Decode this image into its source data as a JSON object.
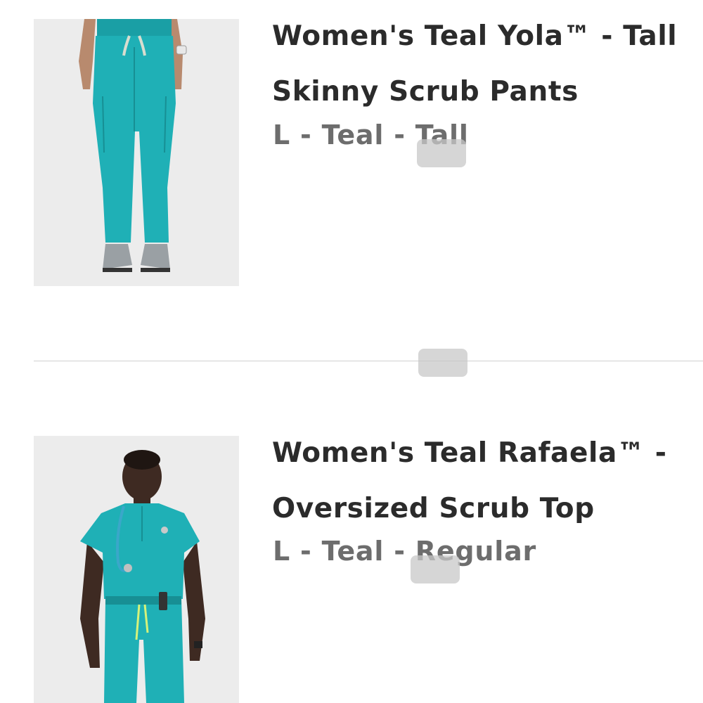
{
  "products": [
    {
      "title_line1": "Women's Teal Yola™ - Tall",
      "title_line2": "Skinny Scrub Pants",
      "variant": "L - Teal - Tall",
      "image": "teal-skinny-scrub-pants-photo"
    },
    {
      "title_line1": "Women's Teal Rafaela™ -",
      "title_line2": "Oversized Scrub Top",
      "variant": "L - Teal - Regular",
      "image": "teal-oversized-scrub-top-photo"
    }
  ],
  "colors": {
    "teal": "#1fb0b6",
    "teal_dark": "#178f94",
    "title_text": "#2b2b2b",
    "variant_text": "#6d6d6d",
    "image_background": "#ececec"
  }
}
